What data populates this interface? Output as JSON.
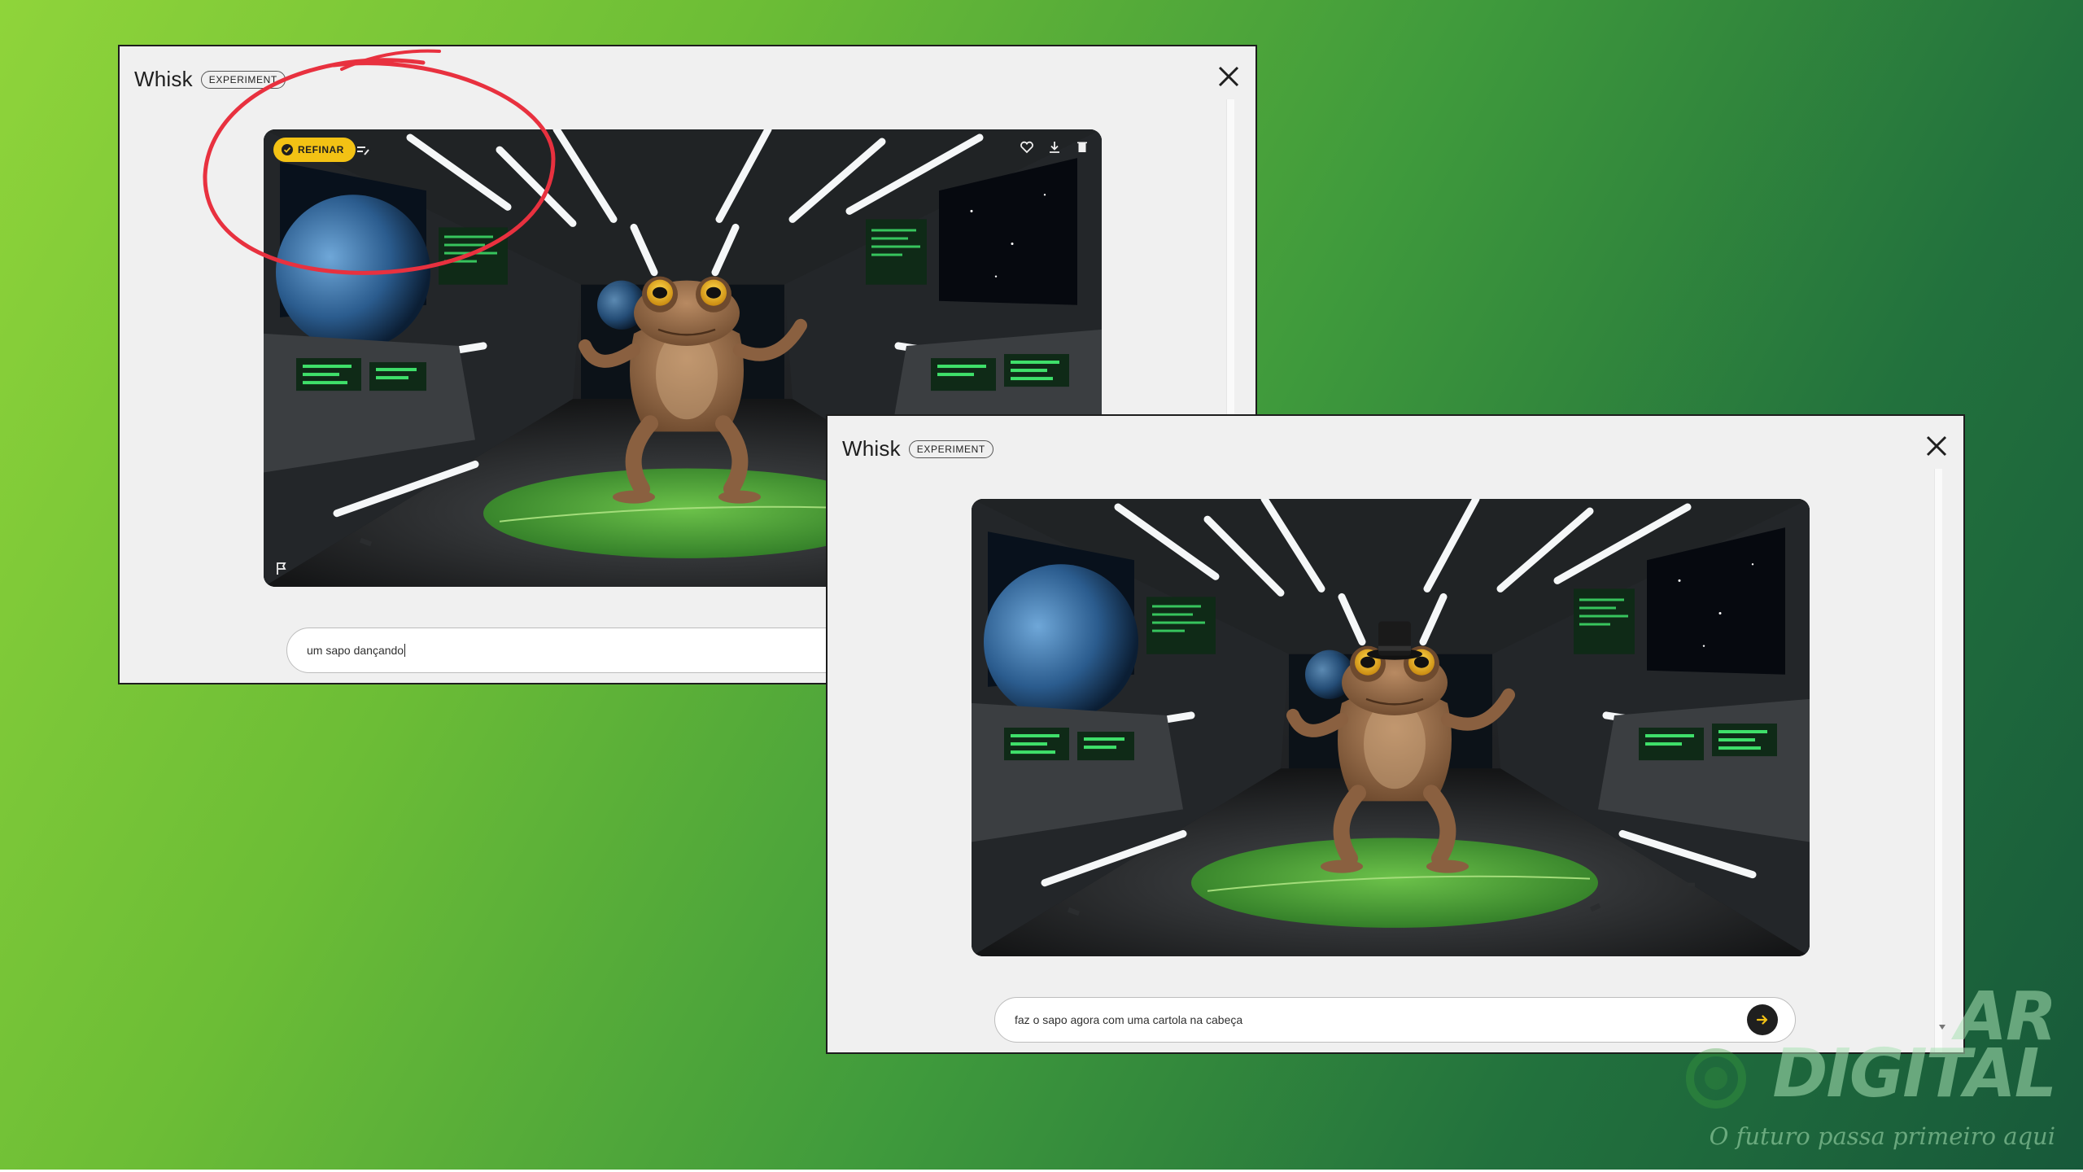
{
  "window_back": {
    "app_name": "Whisk",
    "badge": "EXPERIMENT",
    "refine_label": "REFINAR",
    "prompt_value": "um sapo dançando"
  },
  "window_front": {
    "app_name": "Whisk",
    "badge": "EXPERIMENT",
    "prompt_value": "faz o sapo agora com uma cartola na cabeça"
  },
  "watermark": {
    "line1": "AR",
    "line2": "DIGITAL",
    "tagline": "O futuro passa primeiro aqui"
  },
  "colors": {
    "refine_chip": "#f3c214",
    "annotation": "#e8313f",
    "screen_green": "#3fe06a"
  },
  "icons": {
    "refine_check": "check-circle-icon",
    "refine_edit": "edit-lines-icon",
    "favorite": "heart-icon",
    "download": "download-icon",
    "delete": "trash-icon",
    "report": "flag-icon",
    "close": "close-icon",
    "send": "arrow-right-icon"
  }
}
